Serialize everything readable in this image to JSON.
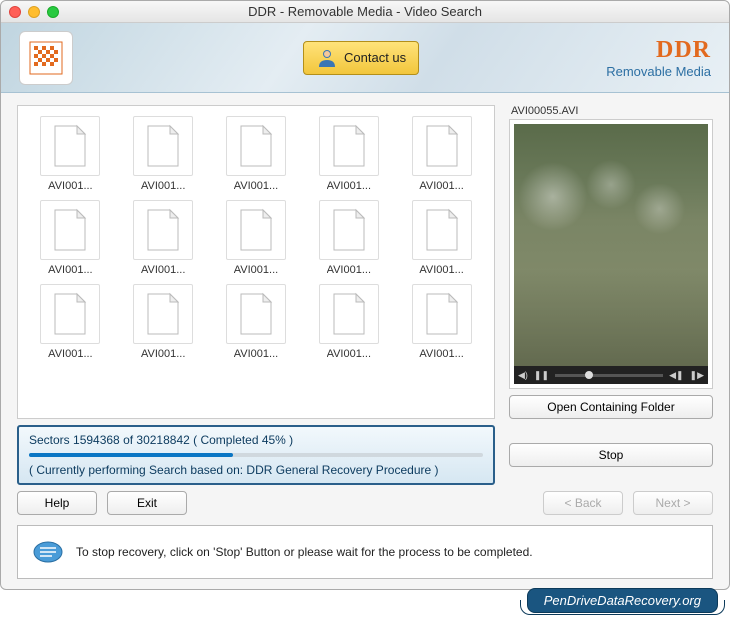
{
  "window": {
    "title": "DDR - Removable Media - Video Search"
  },
  "banner": {
    "contact_label": "Contact us",
    "brand_main": "DDR",
    "brand_sub": "Removable Media"
  },
  "files": [
    "AVI001...",
    "AVI001...",
    "AVI001...",
    "AVI001...",
    "AVI001...",
    "AVI001...",
    "AVI001...",
    "AVI001...",
    "AVI001...",
    "AVI001...",
    "AVI001...",
    "AVI001...",
    "AVI001...",
    "AVI001...",
    "AVI001..."
  ],
  "preview": {
    "filename": "AVI00055.AVI"
  },
  "buttons": {
    "open_folder": "Open Containing Folder",
    "stop": "Stop",
    "help": "Help",
    "exit": "Exit",
    "back": "< Back",
    "next": "Next >"
  },
  "status": {
    "sectors": "Sectors 1594368 of 30218842    ( Completed 45% )",
    "progress_percent": 45,
    "mode": "( Currently performing Search based on: DDR General Recovery Procedure )"
  },
  "hint": "To stop recovery, click on 'Stop' Button or please wait for the process to be completed.",
  "watermark": "PenDriveDataRecovery.org"
}
